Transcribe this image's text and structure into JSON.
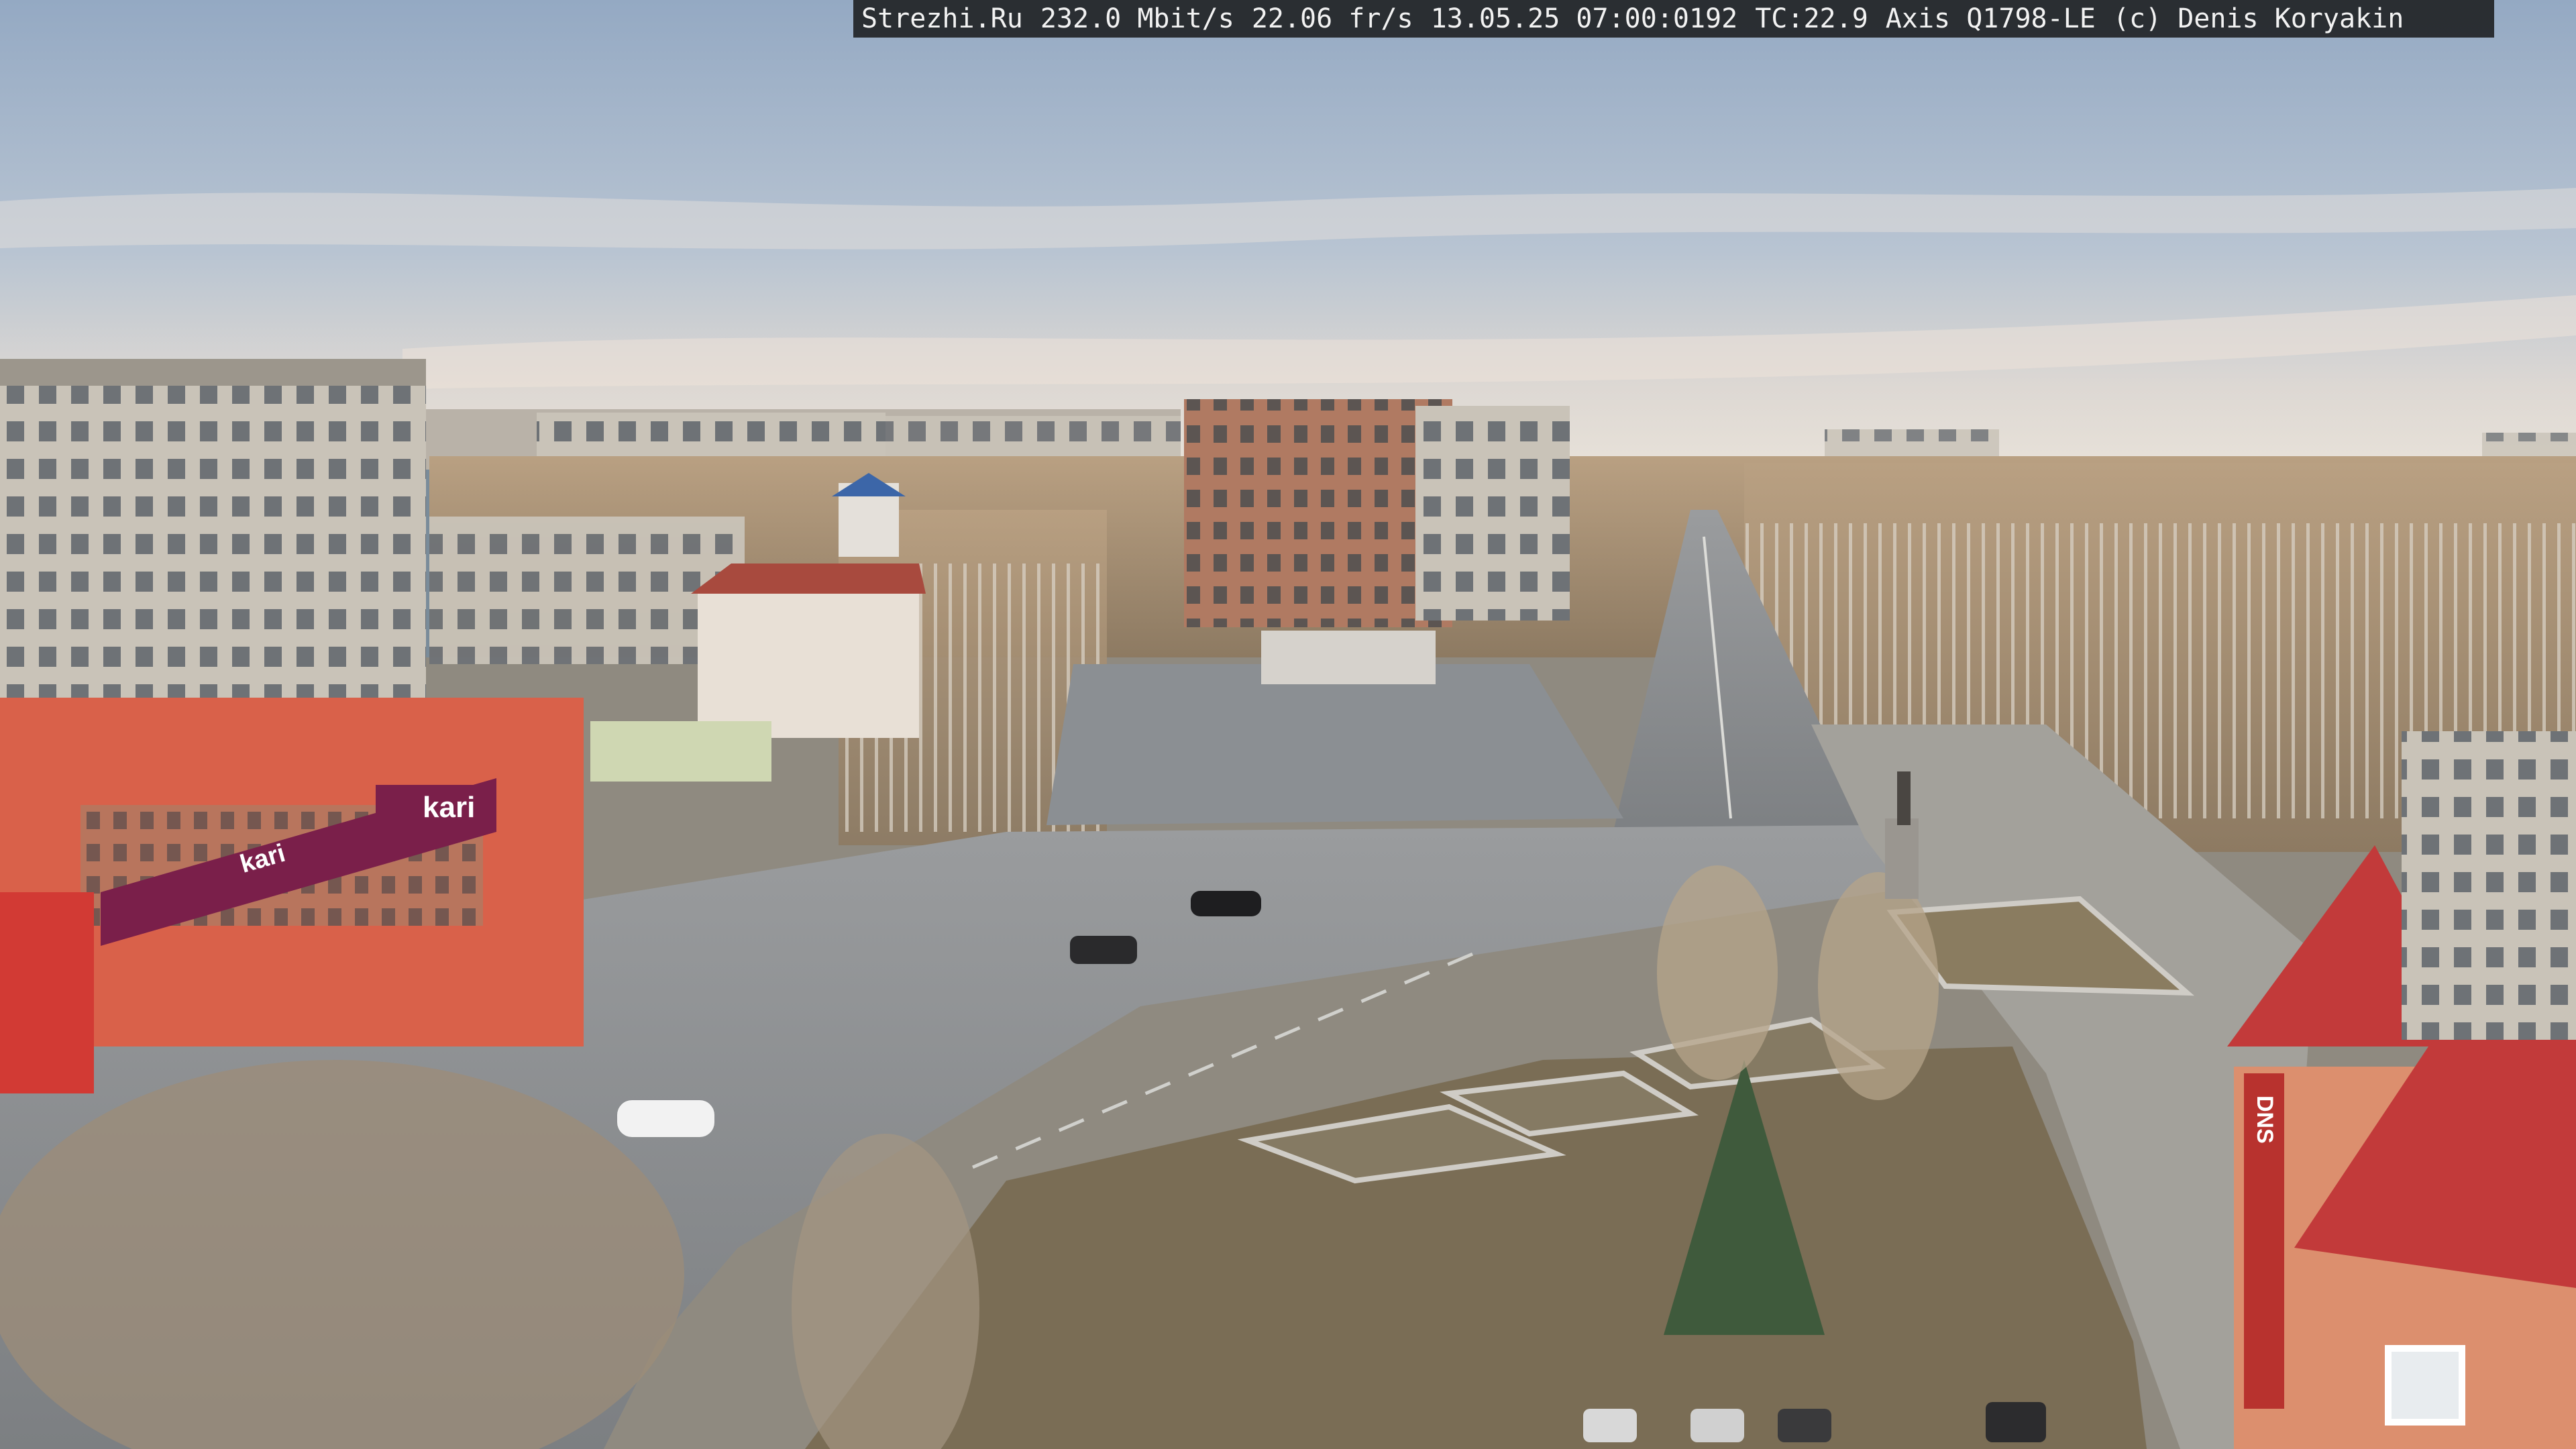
{
  "overlay": {
    "site": "Strezhi.Ru",
    "bitrate": "232.0 Mbit/s",
    "fps": "22.06 fr/s",
    "datetime": "13.05.25 07:00:0192",
    "temperature": "TC:22.9",
    "camera": "Axis Q1798-LE",
    "copyright": "(c) Denis Koryakin"
  },
  "signs": {
    "kari_roof": "kari",
    "kari_banner": "kari",
    "dns": "DNS"
  },
  "colors": {
    "sky_top": "#9fb2c9",
    "sky_horizon": "#e9e2d8",
    "asphalt": "#8a8c8e",
    "store_red": "#d9614a",
    "store_banner": "#7a1f4a",
    "roof_red": "#c23a3a"
  }
}
